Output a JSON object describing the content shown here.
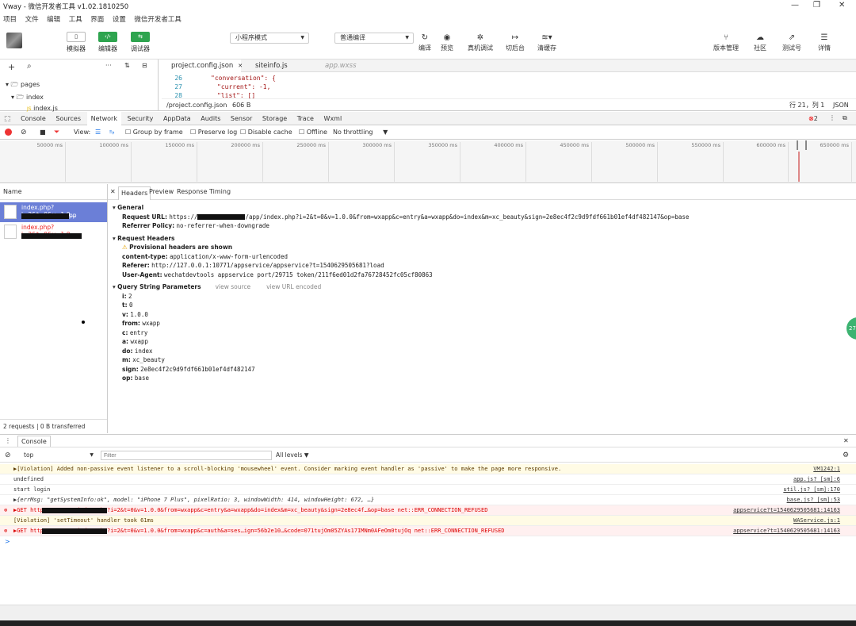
{
  "titlebar": {
    "title": "Vway - 微信开发者工具 v1.02.1810250",
    "min": "—",
    "max": "❐",
    "close": "✕"
  },
  "menu": [
    "项目",
    "文件",
    "编辑",
    "工具",
    "界面",
    "设置",
    "微信开发者工具"
  ],
  "toolbar": {
    "simulator": "模拟器",
    "editor": "编辑器",
    "debugger": "调试器",
    "mode_select": "小程序模式",
    "compile_select": "普通编译",
    "compile": "编译",
    "preview": "预览",
    "remote_debug": "真机调试",
    "background": "切后台",
    "clear_cache": "清缓存",
    "version": "版本管理",
    "community": "社区",
    "test": "测试号",
    "details": "详情"
  },
  "filetree": {
    "folders": [
      "pages",
      "index"
    ],
    "file": "index.js"
  },
  "editor_tabs": [
    "project.config.json",
    "siteinfo.js",
    "app.wxss"
  ],
  "code": {
    "lines": [
      "26",
      "27",
      "28"
    ],
    "text": [
      "\"conversation\": {",
      "\"current\": -1,",
      "\"list\": []"
    ]
  },
  "editor_status": {
    "path": "/project.config.json",
    "size": "606 B",
    "pos": "行 21，列 1",
    "lang": "JSON"
  },
  "devtools_tabs": [
    "Console",
    "Sources",
    "Network",
    "Security",
    "AppData",
    "Audits",
    "Sensor",
    "Storage",
    "Trace",
    "Wxml"
  ],
  "devtools_errors": "2",
  "network_toolbar": {
    "view": "View:",
    "group": "Group by frame",
    "preserve": "Preserve log",
    "disable_cache": "Disable cache",
    "offline": "Offline",
    "throttle": "No throttling"
  },
  "timeline_ticks": [
    "50000 ms",
    "100000 ms",
    "150000 ms",
    "200000 ms",
    "250000 ms",
    "300000 ms",
    "350000 ms",
    "400000 ms",
    "450000 ms",
    "500000 ms",
    "550000 ms",
    "600000 ms",
    "650000 ms"
  ],
  "requests": {
    "header": "Name",
    "items": [
      "index.php?i=2&t=0&v=1.0...",
      "index.php?i=2&t=0&v=1.0..."
    ],
    "item_suffix": "pp",
    "summary": "2 requests | 0 B transferred"
  },
  "detail_tabs": [
    "Headers",
    "Preview",
    "Response",
    "Timing"
  ],
  "general": {
    "title": "General",
    "request_url_label": "Request URL:",
    "request_url_pre": "https://",
    "request_url_post": "/app/index.php?i=2&t=0&v=1.0.0&from=wxapp&c=entry&a=wxapp&do=index&m=xc_beauty&sign=2e8ec4f2c9d9fdf661b01ef4df482147&op=base",
    "referrer_label": "Referrer Policy:",
    "referrer": "no-referrer-when-downgrade"
  },
  "request_headers": {
    "title": "Request Headers",
    "provisional": "Provisional headers are shown",
    "rows": [
      {
        "k": "content-type:",
        "v": "application/x-www-form-urlencoded"
      },
      {
        "k": "Referer:",
        "v": "http://127.0.0.1:10771/appservice/appservice?t=1540629505681?load"
      },
      {
        "k": "User-Agent:",
        "v": "wechatdevtools appservice port/29715 token/211f6ed01d2fa76728452fc05cf80863"
      }
    ]
  },
  "query": {
    "title": "Query String Parameters",
    "view_source": "view source",
    "view_encoded": "view URL encoded",
    "rows": [
      {
        "k": "i:",
        "v": "2"
      },
      {
        "k": "t:",
        "v": "0"
      },
      {
        "k": "v:",
        "v": "1.0.0"
      },
      {
        "k": "from:",
        "v": "wxapp"
      },
      {
        "k": "c:",
        "v": "entry"
      },
      {
        "k": "a:",
        "v": "wxapp"
      },
      {
        "k": "do:",
        "v": "index"
      },
      {
        "k": "m:",
        "v": "xc_beauty"
      },
      {
        "k": "sign:",
        "v": "2e8ec4f2c9d9fdf661b01ef4df482147"
      },
      {
        "k": "op:",
        "v": "base"
      }
    ]
  },
  "side_badge": "27",
  "console": {
    "tab": "Console",
    "context": "top",
    "filter_placeholder": "Filter",
    "levels": "All levels ▼",
    "rows": [
      {
        "type": "warn",
        "text": "▶[Violation] Added non-passive event listener to a scroll-blocking 'mousewheel' event. Consider marking event handler as 'passive' to make the page more responsive.",
        "src": "VM1242:1"
      },
      {
        "type": "log",
        "text": "undefined",
        "src": "app.js? [sm]:6"
      },
      {
        "type": "log",
        "text": "start login",
        "src": "util.js? [sm]:170"
      },
      {
        "type": "log",
        "text": "▶{errMsg: \"getSystemInfo:ok\", model: \"iPhone 7 Plus\", pixelRatio: 3, windowWidth: 414, windowHeight: 672, …}",
        "src": "base.js? [sm]:53"
      },
      {
        "type": "err",
        "text": "▶GET https://            /app/index.php?i=2&t=0&v=1.0.0&from=wxapp&c=entry&a=wxapp&do=index&m=xc_beauty&sign=2e8ec4f…&op=base net::ERR_CONNECTION_REFUSED",
        "src": "appservice?t=1540629505681:14163"
      },
      {
        "type": "warn",
        "text": "[Violation] 'setTimeout' handler took 61ms",
        "src": "WAService.js:1"
      },
      {
        "type": "err",
        "text": "▶GET https://            /app/index.php?i=2&t=0&v=1.0.0&from=wxapp&c=auth&a=ses…ign=56b2e10…&code=071tujOm05ZYAs17IMNm0AFeOm0tujOq net::ERR_CONNECTION_REFUSED",
        "src": "appservice?t=1540629505681:14163"
      }
    ],
    "prompt": ">"
  }
}
